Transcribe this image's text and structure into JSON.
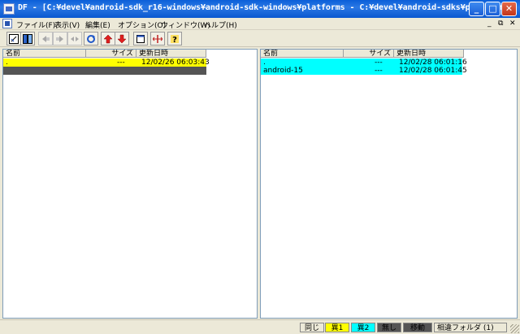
{
  "window": {
    "title": "DF - [C:¥devel¥android-sdk_r16-windows¥android-sdk-windows¥platforms  -  C:¥devel¥android-sdks¥platforms]",
    "minimize": "_",
    "maximize": "□",
    "close": "✕"
  },
  "menu": {
    "items": [
      "ファイル(F)",
      "表示(V)",
      "編集(E)",
      "オプション(O)",
      "ウィンドウ(W)",
      "ヘルプ(H)"
    ],
    "mdi_minimize": "_",
    "mdi_restore": "⧉",
    "mdi_close": "✕"
  },
  "toolbar": {
    "icons": [
      "open-folders-icon",
      "compare-icon",
      "copy-left-icon",
      "copy-right-icon",
      "copy-both-icon",
      "refresh-icon",
      "move-up-icon",
      "move-down-icon",
      "window-icon",
      "split-icon",
      "help-icon"
    ]
  },
  "columns": {
    "name": "名前",
    "size": "サイズ",
    "date": "更新日時"
  },
  "left_pane": {
    "rows": [
      {
        "name": ".",
        "size": "---",
        "date": "12/02/26 06:03:43",
        "bg": "#ffff00",
        "fg": "#000000"
      },
      {
        "name": "",
        "size": "",
        "date": "",
        "bg": "#555555",
        "fg": "#ffffff"
      }
    ]
  },
  "right_pane": {
    "rows": [
      {
        "name": ".",
        "size": "---",
        "date": "12/02/28 06:01:16",
        "bg": "#00ffff",
        "fg": "#000000"
      },
      {
        "name": "android-15",
        "size": "---",
        "date": "12/02/28 06:01:45",
        "bg": "#00ffff",
        "fg": "#000000"
      }
    ]
  },
  "statusbar": {
    "same": "同じ",
    "diff1": "異1",
    "diff2": "異2",
    "none": "無し",
    "moved": "移動",
    "info": "相違フォルダ (1)",
    "colors": {
      "same": "#ece9d8",
      "diff1": "#ffff00",
      "diff2": "#00ffff",
      "none": "#555555",
      "moved": "#555555"
    }
  }
}
